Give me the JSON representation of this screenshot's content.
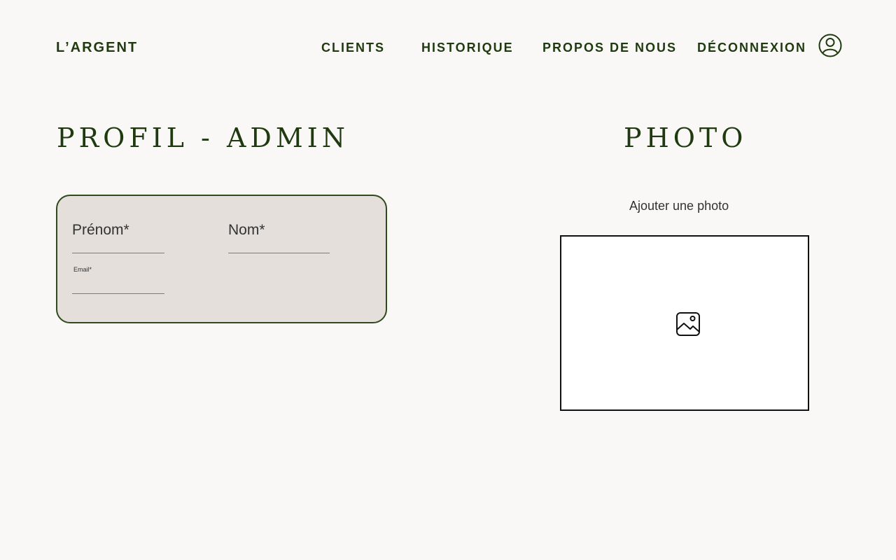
{
  "header": {
    "brand": "L’ARGENT",
    "nav": {
      "clients": "CLIENTS",
      "historique": "HISTORIQUE",
      "propos": "PROPOS DE NOUS",
      "deconnexion": "DÉCONNEXION"
    },
    "user_icon": "user-circle-icon"
  },
  "profile": {
    "title": "PROFIL - ADMIN",
    "fields": {
      "first_name_label": "Prénom*",
      "last_name_label": "Nom*",
      "email_label": "Email*"
    }
  },
  "photo": {
    "title": "PHOTO",
    "add_label": "Ajouter une photo",
    "placeholder_icon": "image-icon"
  },
  "colors": {
    "accent": "#1f3a0f",
    "page_background": "#f9f8f6",
    "card_background": "#e4dfda",
    "card_border": "#2f4a1c"
  }
}
